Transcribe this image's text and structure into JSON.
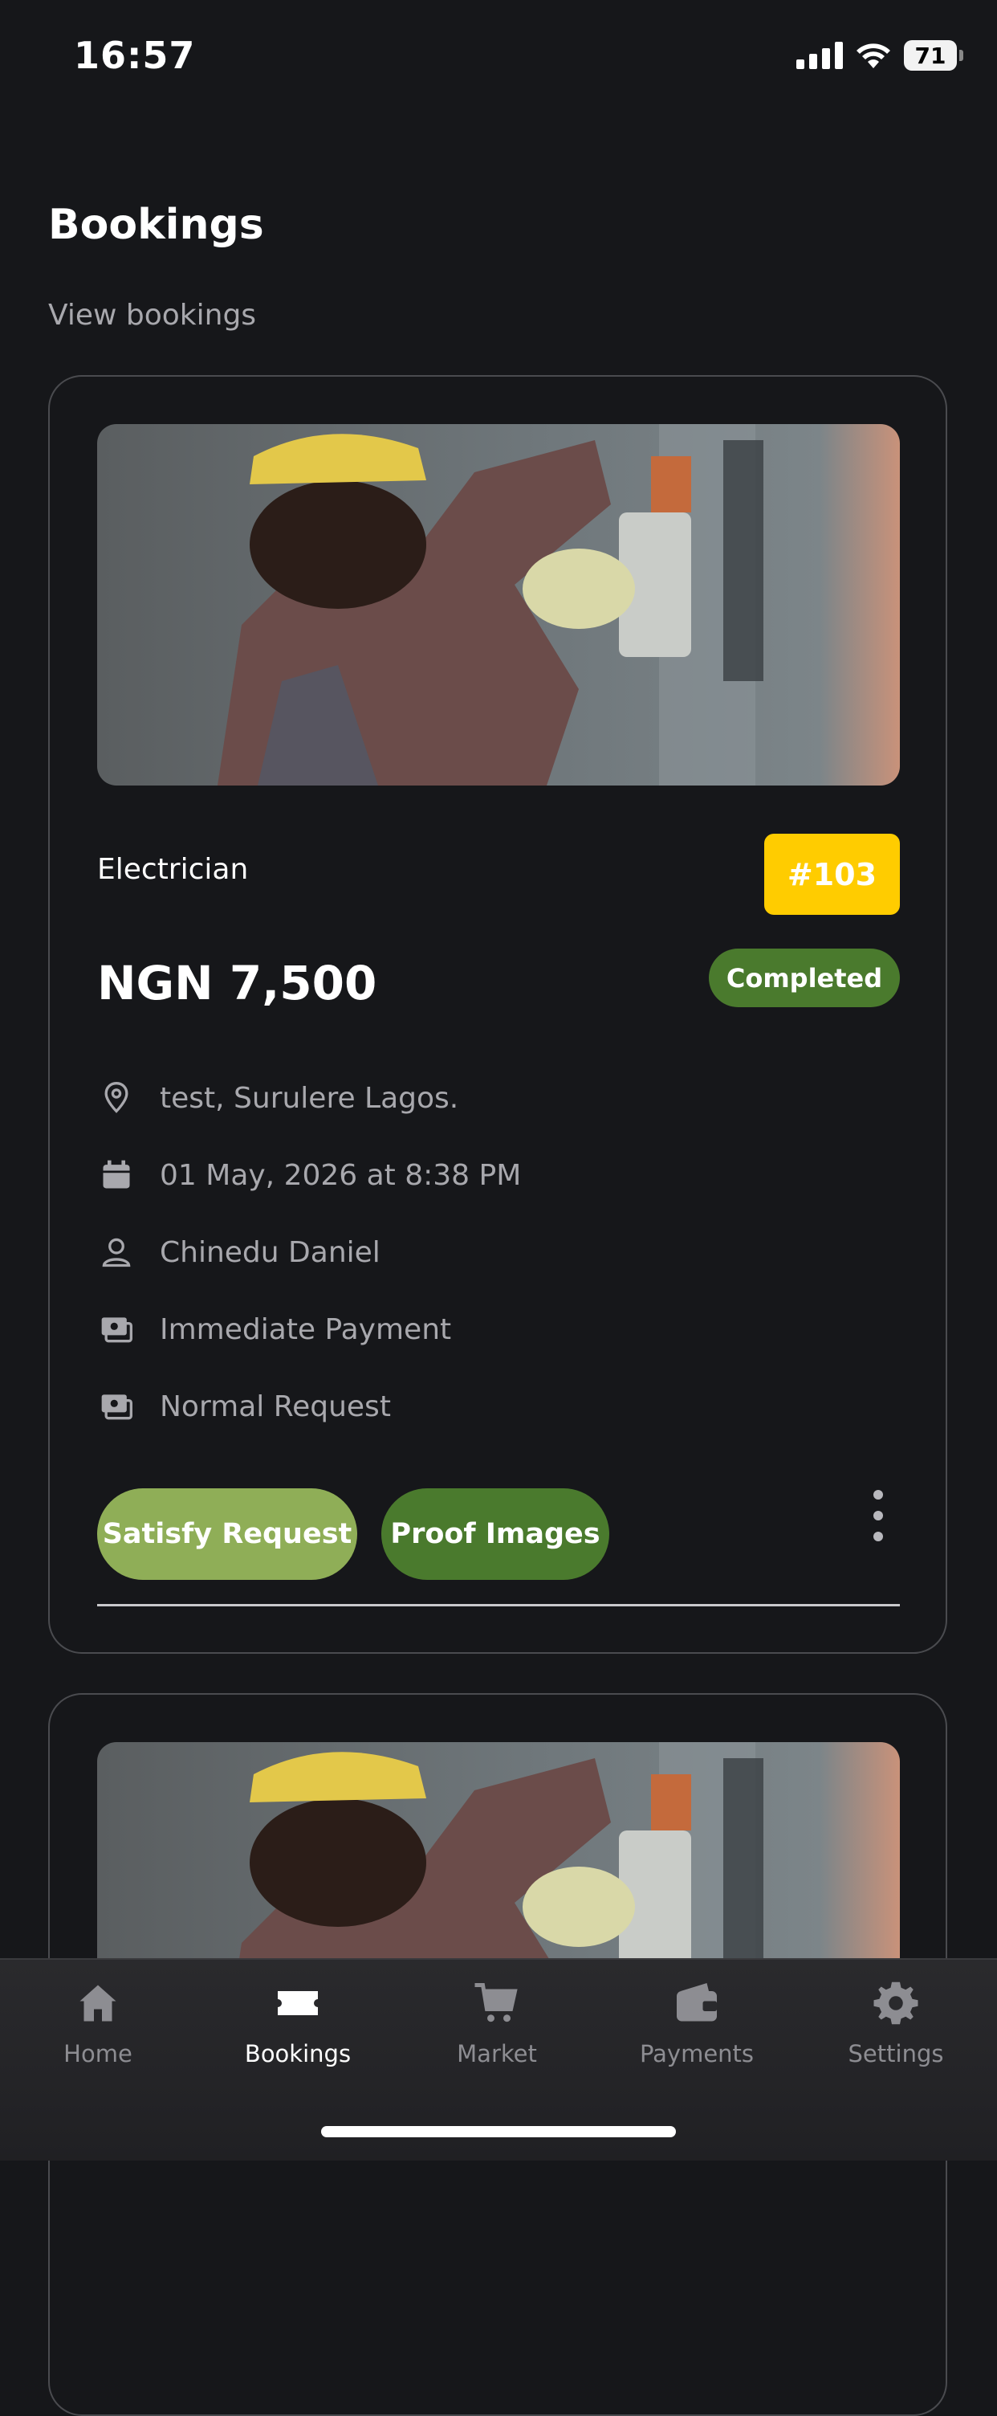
{
  "status_bar": {
    "time": "16:57",
    "battery": "71"
  },
  "header": {
    "title": "Bookings",
    "subtitle": "View bookings"
  },
  "bookings": [
    {
      "image": "electrician-photo",
      "service": "Electrician",
      "order_id": "#103",
      "price": "NGN 7,500",
      "status": "Completed",
      "address": "test, Surulere Lagos.",
      "datetime": "01 May, 2026 at 8:38 PM",
      "customer": "Chinedu Daniel",
      "payment_type": "Immediate Payment",
      "request_type": "Normal Request",
      "actions": {
        "satisfy": "Satisfy Request",
        "proof": "Proof Images"
      }
    },
    {
      "image": "electrician-photo"
    }
  ],
  "tabs": [
    {
      "label": "Home",
      "icon": "home-icon",
      "active": false
    },
    {
      "label": "Bookings",
      "icon": "ticket-icon",
      "active": true
    },
    {
      "label": "Market",
      "icon": "cart-icon",
      "active": false
    },
    {
      "label": "Payments",
      "icon": "wallet-icon",
      "active": false
    },
    {
      "label": "Settings",
      "icon": "gear-icon",
      "active": false
    }
  ],
  "colors": {
    "background": "#16171a",
    "order_badge": "#ffcc00",
    "status_completed": "#4a7a2d",
    "satisfy_button": "#8fae57",
    "proof_button": "#4a7a2d"
  }
}
